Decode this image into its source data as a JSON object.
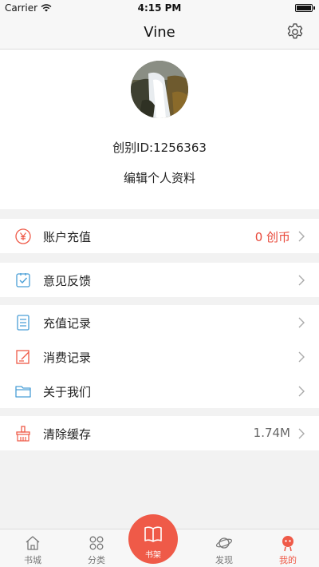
{
  "status": {
    "carrier": "Carrier",
    "time": "4:15 PM"
  },
  "nav": {
    "title": "Vine"
  },
  "profile": {
    "uid": "创别ID:1256363",
    "edit": "编辑个人资料"
  },
  "menu": {
    "recharge": {
      "label": "账户充值",
      "value": "0 创币"
    },
    "feedback": {
      "label": "意见反馈"
    },
    "recharge_history": {
      "label": "充值记录"
    },
    "consume_history": {
      "label": "消费记录"
    },
    "about": {
      "label": "关于我们"
    },
    "cache": {
      "label": "清除缓存",
      "value": "1.74M"
    }
  },
  "tabs": {
    "bookstore": "书城",
    "category": "分类",
    "shelf": "书架",
    "discover": "发现",
    "mine": "我的"
  },
  "colors": {
    "accent": "#ef5a48",
    "blue_icon": "#4a9fd6",
    "red_value": "#e8483a"
  },
  "icons": {
    "status": [
      "wifi-icon",
      "battery-icon"
    ],
    "nav": "gear-icon",
    "menu": [
      "yen-coin-icon",
      "feedback-icon",
      "list-icon",
      "edit-icon",
      "folder-icon",
      "broom-icon"
    ],
    "tabs": [
      "home-icon",
      "grid-icon",
      "book-icon",
      "planet-icon",
      "user-icon"
    ]
  }
}
